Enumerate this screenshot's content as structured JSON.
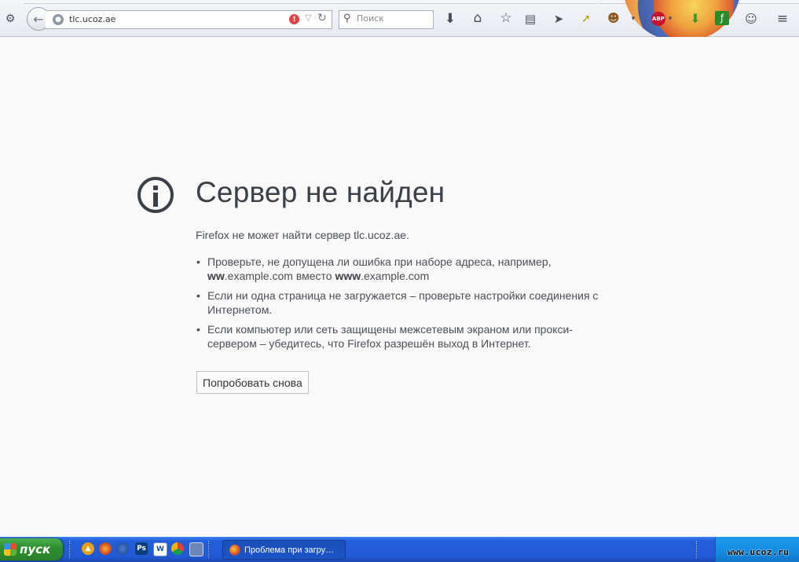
{
  "browser": {
    "url": "tlc.ucoz.ae",
    "search_placeholder": "Поиск"
  },
  "error_page": {
    "title": "Сервер не найден",
    "intro": "Firefox не может найти сервер tlc.ucoz.ae.",
    "item1_part1": "Проверьте, не допущена ли ошибка при наборе адреса, например,",
    "item1_ww": "ww",
    "item1_mid": ".example.com вместо ",
    "item1_www": "www",
    "item1_end": ".example.com",
    "item2": "Если ни одна страница не загружается – проверьте настройки соединения с Интернетом.",
    "item3": "Если компьютер или сеть защищены межсетевым экраном или прокси-сервером – убедитесь, что Firefox разрешён выход в Интернет.",
    "retry_label": "Попробовать снова"
  },
  "taskbar": {
    "start_label": "пуск",
    "task_label": "Проблема при загру…",
    "watermark": "www.ucoz.ru"
  },
  "icons": {
    "abp": "ABP",
    "photoshop": "Ps",
    "word": "W"
  },
  "colors": {
    "error_text": "#3b4046",
    "taskbar_blue": "#245edb",
    "start_green": "#2f8f2f"
  }
}
